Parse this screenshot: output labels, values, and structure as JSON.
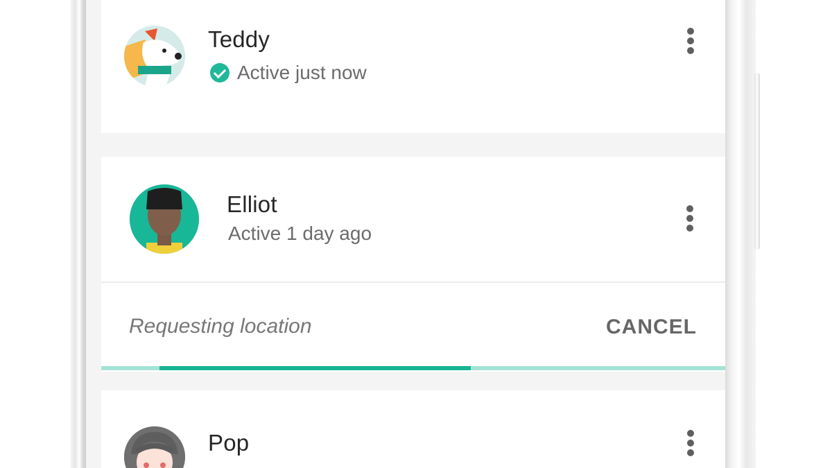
{
  "contacts": [
    {
      "name": "Teddy",
      "status": "Active just now",
      "active_now": true,
      "avatar_icon": "dog-avatar-icon"
    },
    {
      "name": "Elliot",
      "status": "Active 1 day ago",
      "active_now": false,
      "avatar_icon": "person-avatar-icon"
    },
    {
      "name": "Pop",
      "status": "",
      "active_now": false,
      "avatar_icon": "grandma-avatar-icon"
    }
  ],
  "request": {
    "text": "Requesting location",
    "cancel_label": "CANCEL",
    "progress": 0.55
  },
  "colors": {
    "accent": "#17b594",
    "accent_light": "#a4e3d6",
    "background": "#f4f4f4",
    "card": "#ffffff"
  }
}
